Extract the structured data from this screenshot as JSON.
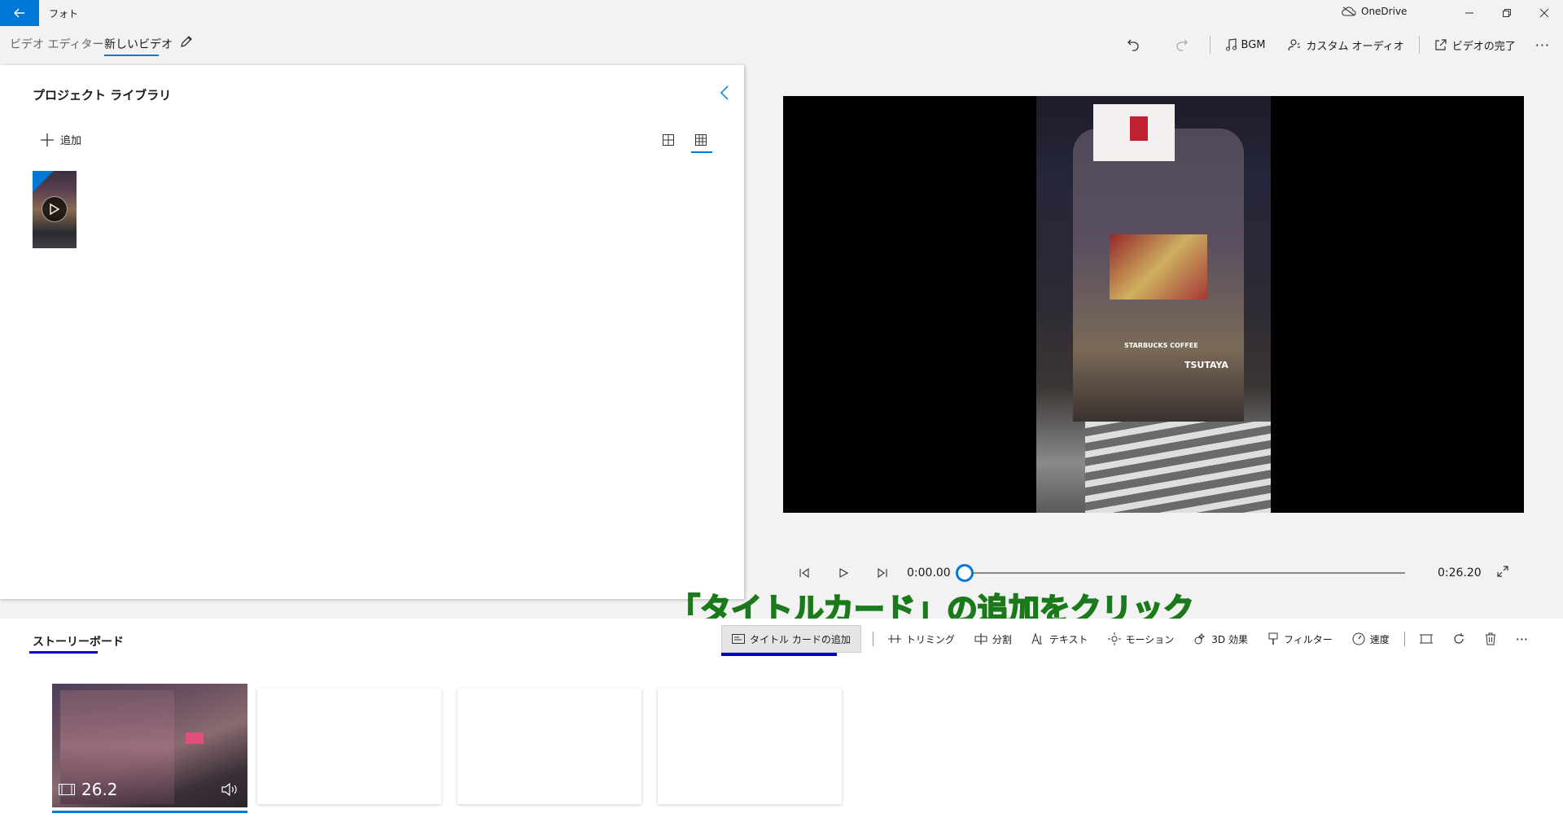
{
  "titlebar": {
    "app_title": "フォト",
    "onedrive_label": "OneDrive"
  },
  "breadcrumb": {
    "root": "ビデオ エディター",
    "current": "新しいビデオ"
  },
  "commands": {
    "bgm": "BGM",
    "custom_audio": "カスタム オーディオ",
    "finish_video": "ビデオの完了"
  },
  "library": {
    "title": "プロジェクト ライブラリ",
    "add_label": "追加"
  },
  "player": {
    "time_start": "0:00.00",
    "time_end": "0:26.20",
    "progress": 0
  },
  "preview_signs": {
    "tsutaya": "TSUTAYA",
    "starbucks": "STARBUCKS COFFEE"
  },
  "annotation": {
    "text": "「タイトルカード」の追加をクリック"
  },
  "storyboard": {
    "title": "ストーリーボード",
    "tools": {
      "title_card": "タイトル カードの追加",
      "trimming": "トリミング",
      "split": "分割",
      "text": "テキスト",
      "motion": "モーション",
      "effects_3d": "3D 効果",
      "filter": "フィルター",
      "speed": "速度"
    },
    "clip": {
      "duration": "26.2"
    }
  },
  "colors": {
    "accent": "#0078d7",
    "annotation_fill": "#22a8e8",
    "annotation_stroke": "#1a7a1a",
    "highlight_underline": "#0000c8"
  }
}
